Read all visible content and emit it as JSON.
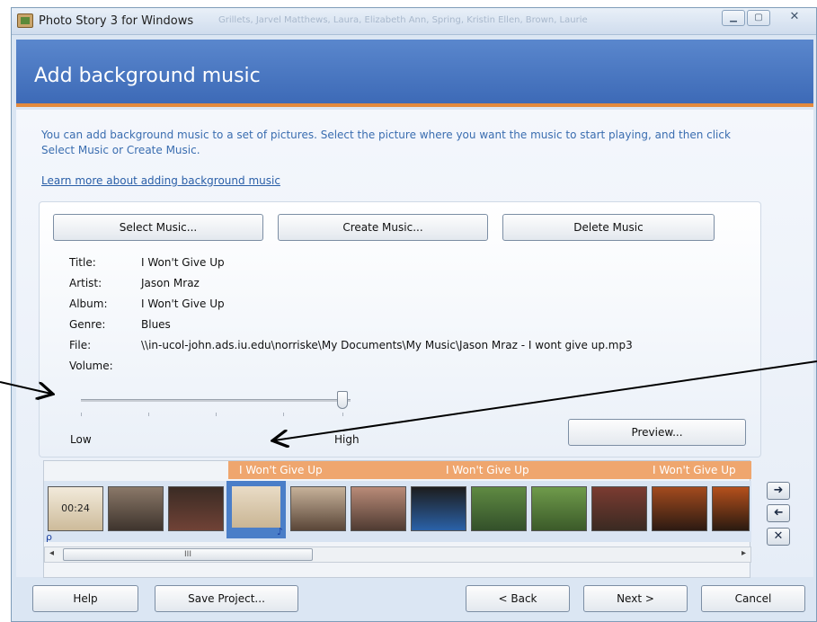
{
  "window": {
    "title": "Photo Story 3 for Windows",
    "faint_title": "Grillets, Jarvel Matthews,  Laura, Elizabeth Ann, Spring, Kristin Ellen, Brown, Laurie"
  },
  "header": {
    "title": "Add background music"
  },
  "instructions": "You can add background music to a set of pictures.  Select the picture where you want the music to start playing, and then click Select Music or Create Music.",
  "learn_link": "Learn more about adding background music",
  "buttons": {
    "select_music": "Select Music...",
    "create_music": "Create Music...",
    "delete_music": "Delete Music",
    "preview": "Preview..."
  },
  "info": {
    "title_label": "Title:",
    "title": "I Won't Give Up",
    "artist_label": "Artist:",
    "artist": "Jason Mraz",
    "album_label": "Album:",
    "album": "I Won't Give Up",
    "genre_label": "Genre:",
    "genre": "Blues",
    "file_label": "File:",
    "file": "\\\\in-ucol-john.ads.iu.edu\\norriske\\My Documents\\My Music\\Jason Mraz - I wont give up.mp3",
    "volume_label": "Volume:"
  },
  "volume": {
    "low": "Low",
    "high": "High",
    "level": 0.98
  },
  "timeline": {
    "music_labels": [
      "I Won't Give Up",
      "I Won't Give Up",
      "I Won't Give Up"
    ],
    "first_thumb_time": "00:24",
    "scroll_grip": "III"
  },
  "footer": {
    "help": "Help",
    "save_project": "Save Project...",
    "back": "< Back",
    "next": "Next >",
    "cancel": "Cancel"
  },
  "colors": {
    "header": "#3d6ab7",
    "accent": "#e38a3e",
    "music_band": "#efa66e",
    "link": "#2a5fa8"
  }
}
